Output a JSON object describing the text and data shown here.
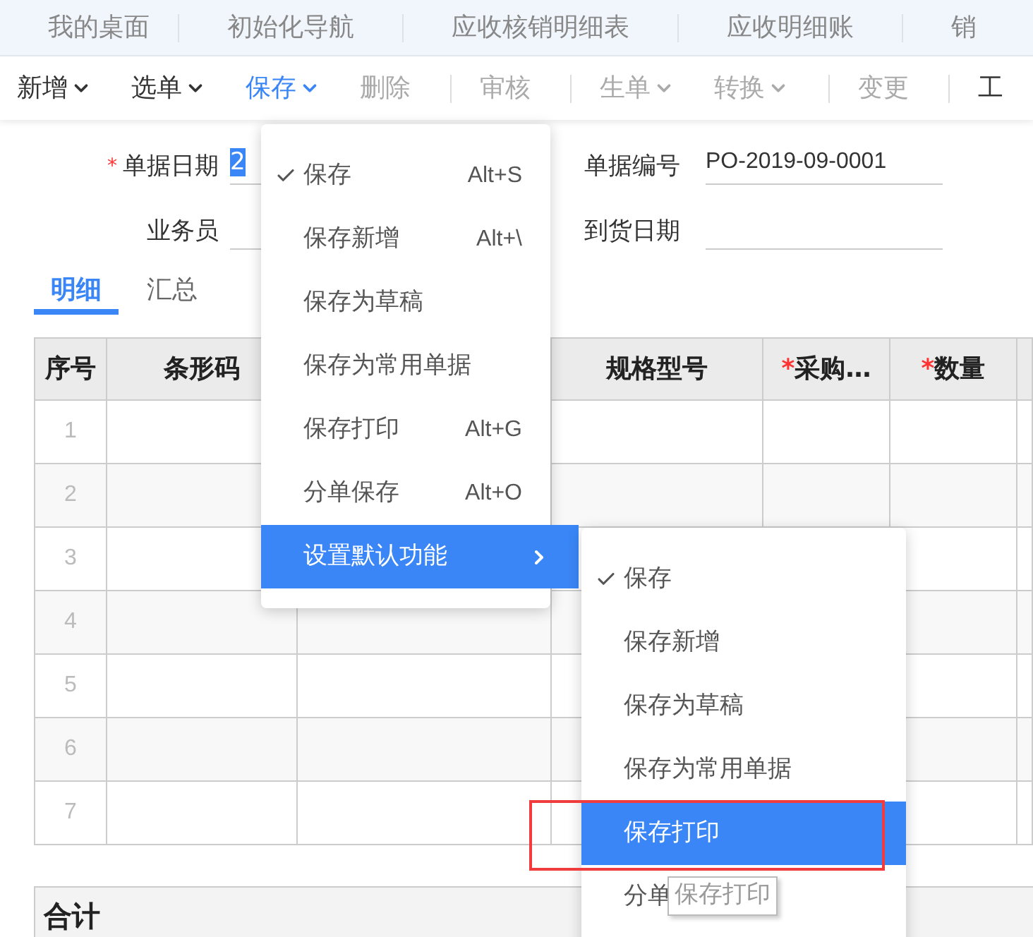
{
  "nav_tabs": [
    {
      "label": "我的桌面"
    },
    {
      "label": "初始化导航"
    },
    {
      "label": "应收核销明细表"
    },
    {
      "label": "应收明细账"
    },
    {
      "label": "销"
    }
  ],
  "toolbar": [
    {
      "label": "新增",
      "dropdown": true,
      "disabled": false,
      "selected": false,
      "divider_before": false
    },
    {
      "label": "选单",
      "dropdown": true,
      "disabled": false,
      "selected": false,
      "divider_before": false
    },
    {
      "label": "保存",
      "dropdown": true,
      "disabled": false,
      "selected": true,
      "divider_before": false
    },
    {
      "label": "删除",
      "dropdown": false,
      "disabled": true,
      "selected": false,
      "divider_before": false
    },
    {
      "label": "审核",
      "dropdown": false,
      "disabled": true,
      "selected": false,
      "divider_before": true
    },
    {
      "label": "生单",
      "dropdown": true,
      "disabled": true,
      "selected": false,
      "divider_before": true
    },
    {
      "label": "转换",
      "dropdown": true,
      "disabled": true,
      "selected": false,
      "divider_before": false
    },
    {
      "label": "变更",
      "dropdown": false,
      "disabled": true,
      "selected": false,
      "divider_before": true
    },
    {
      "label": "工",
      "dropdown": false,
      "disabled": false,
      "selected": false,
      "divider_before": true
    }
  ],
  "form": {
    "left": [
      {
        "label": "单据日期",
        "mark": "*",
        "value": "2",
        "text_selected": true
      },
      {
        "label": "业务员"
      }
    ],
    "right": [
      {
        "label": "单据编号",
        "value": "PO-2019-09-0001"
      },
      {
        "label": "到货日期"
      }
    ]
  },
  "detail_tabs": [
    {
      "label": "明细",
      "selected": true
    },
    {
      "label": "汇总",
      "selected": false
    }
  ],
  "table": {
    "columns": [
      {
        "label": "序号"
      },
      {
        "label": "条形码"
      },
      {
        "label": "规格型号"
      },
      {
        "label": "采购…",
        "mark": "*"
      },
      {
        "label": "数量",
        "mark": "*"
      }
    ],
    "rows": [
      "1",
      "2",
      "3",
      "4",
      "5",
      "6",
      "7"
    ],
    "footer": "合计"
  },
  "save_menu": [
    {
      "label": "保存",
      "checked": true,
      "shortcut": "Alt+S",
      "selected": false,
      "submenu": false
    },
    {
      "label": "保存新增",
      "checked": false,
      "shortcut": "Alt+\\",
      "selected": false,
      "submenu": false
    },
    {
      "label": "保存为草稿",
      "checked": false,
      "selected": false,
      "submenu": false
    },
    {
      "label": "保存为常用单据",
      "checked": false,
      "selected": false,
      "submenu": false
    },
    {
      "label": "保存打印",
      "checked": false,
      "shortcut": "Alt+G",
      "selected": false,
      "submenu": false
    },
    {
      "label": "分单保存",
      "checked": false,
      "shortcut": "Alt+O",
      "selected": false,
      "submenu": false
    },
    {
      "label": "设置默认功能",
      "checked": false,
      "selected": true,
      "submenu": true
    }
  ],
  "default_submenu": [
    {
      "label": "保存",
      "checked": true,
      "selected": false
    },
    {
      "label": "保存新增",
      "checked": false,
      "selected": false
    },
    {
      "label": "保存为草稿",
      "checked": false,
      "selected": false
    },
    {
      "label": "保存为常用单据",
      "checked": false,
      "selected": false
    },
    {
      "label": "保存打印",
      "checked": false,
      "selected": true
    },
    {
      "label": "分单",
      "checked": false,
      "selected": false
    }
  ],
  "tooltip": "保存打印"
}
